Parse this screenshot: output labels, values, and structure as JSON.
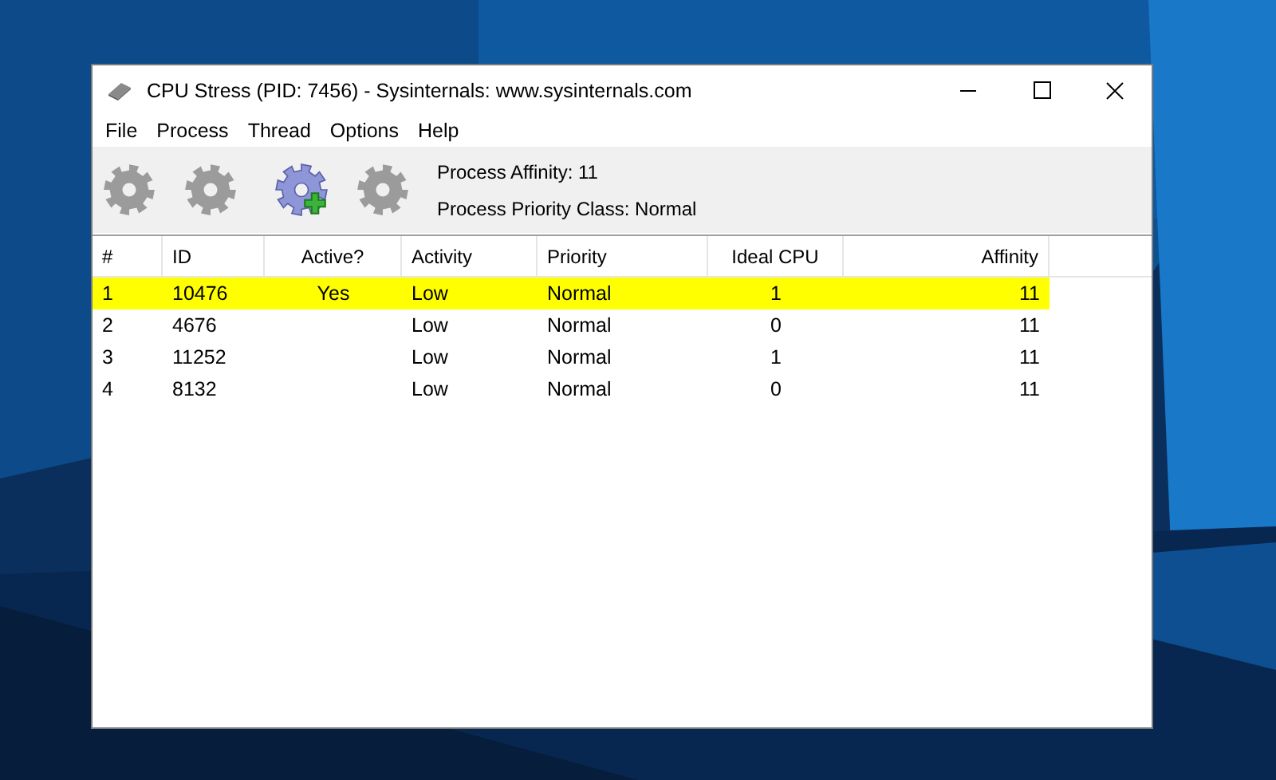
{
  "window": {
    "title": "CPU Stress (PID: 7456) - Sysinternals: www.sysinternals.com"
  },
  "menu": [
    "File",
    "Process",
    "Thread",
    "Options",
    "Help"
  ],
  "toolbar": {
    "groups": [
      [
        {
          "kind": "gear",
          "disabled": true
        },
        {
          "kind": "gear",
          "disabled": true
        }
      ],
      [
        {
          "kind": "gear-add",
          "disabled": false
        },
        {
          "kind": "gear",
          "disabled": true
        }
      ]
    ],
    "info": [
      "Process Affinity: 11",
      "Process Priority Class: Normal"
    ]
  },
  "table": {
    "columns": [
      "#",
      "ID",
      "Active?",
      "Activity",
      "Priority",
      "Ideal CPU",
      "Affinity"
    ],
    "rows": [
      {
        "selected": true,
        "cells": [
          "1",
          "10476",
          "Yes",
          "Low",
          "Normal",
          "1",
          "11"
        ]
      },
      {
        "selected": false,
        "cells": [
          "2",
          "4676",
          null,
          "Low",
          "Normal",
          "0",
          "11"
        ]
      },
      {
        "selected": false,
        "cells": [
          "3",
          "11252",
          null,
          "Low",
          "Normal",
          "1",
          "11"
        ]
      },
      {
        "selected": false,
        "cells": [
          "4",
          "8132",
          null,
          "Low",
          "Normal",
          "0",
          "11"
        ]
      }
    ]
  }
}
